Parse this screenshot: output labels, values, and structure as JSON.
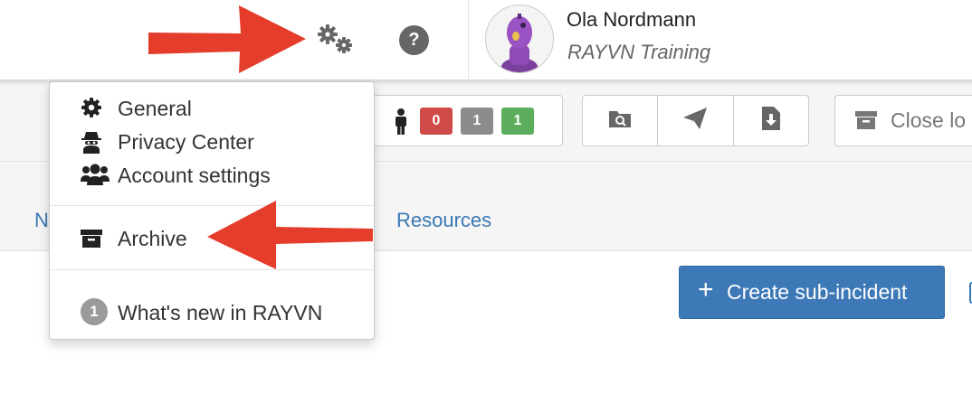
{
  "user": {
    "name": "Ola Nordmann",
    "organization": "RAYVN Training"
  },
  "header": {
    "help_symbol": "?"
  },
  "counts": [
    {
      "value": "0",
      "color": "#cf4b47"
    },
    {
      "value": "1",
      "color": "#8c8c8c"
    },
    {
      "value": "1",
      "color": "#5cae5c"
    }
  ],
  "toolbar": {
    "icon_buttons": [
      "search-document-icon",
      "paper-plane-icon",
      "download-file-icon"
    ],
    "close_label": "Close lo"
  },
  "tabs": {
    "partial_left": "N",
    "resources": "Resources"
  },
  "main": {
    "create_subincident": "Create sub-incident",
    "create_symbol": "+"
  },
  "menu": {
    "general": "General",
    "privacy_center": "Privacy Center",
    "account_settings": "Account settings",
    "archive": "Archive",
    "whats_new": "What's new in RAYVN",
    "whats_new_count": "1"
  },
  "colors": {
    "accent": "#3d78b7",
    "annotation_arrow": "#e53d2b",
    "link": "#3a78b4"
  }
}
